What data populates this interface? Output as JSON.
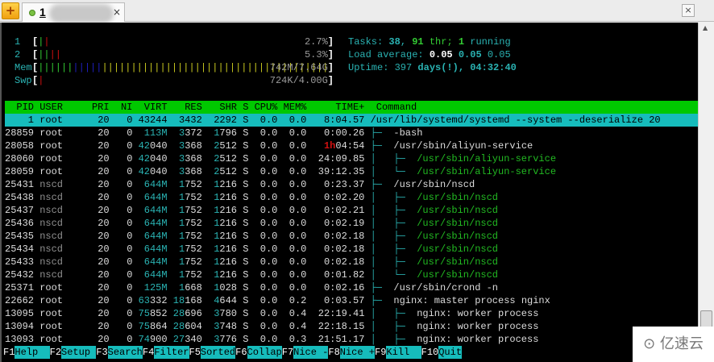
{
  "tabbar": {
    "tab_label": "1",
    "close": "×",
    "win_close": "×",
    "add": "+"
  },
  "meters": [
    {
      "label": "1",
      "value": "2.7%",
      "bars": [
        [
          "#33cc33",
          1
        ],
        [
          "#d01010",
          1
        ]
      ]
    },
    {
      "label": "2",
      "value": "5.3%",
      "bars": [
        [
          "#33cc33",
          2
        ],
        [
          "#d01010",
          2
        ]
      ]
    },
    {
      "label": "Mem",
      "value": "742M/7.64G",
      "bars": [
        [
          "#33cc33",
          6
        ],
        [
          "#2020c0",
          5
        ],
        [
          "#c8c820",
          40
        ]
      ]
    },
    {
      "label": "Swp",
      "value": "724K/4.00G",
      "bars": [
        [
          "#d01010",
          1
        ]
      ]
    }
  ],
  "stats": {
    "tasks_label": "Tasks: ",
    "tasks": "38",
    "thr": "91",
    "thr_label": " thr; ",
    "running": "1",
    "running_label": " running",
    "load_label": "Load average: ",
    "load1": "0.05",
    "load5": "0.05",
    "load15": "0.05",
    "uptime_label": "Uptime: ",
    "uptime_days": "397",
    "uptime_days_label": " days(!), ",
    "uptime_time": "04:32:40"
  },
  "columns": [
    "PID",
    "USER",
    "PRI",
    "NI",
    "VIRT",
    "RES",
    "SHR",
    "S",
    "CPU%",
    "MEM%",
    "TIME+",
    "Command"
  ],
  "processes": [
    {
      "pid": "1",
      "user": "root",
      "pri": "20",
      "ni": "0",
      "virt": "43244",
      "res": "3432",
      "shr": "2292",
      "s": "S",
      "cpu": "0.0",
      "mem": "0.0",
      "time": "8:04.57",
      "tree": "",
      "cmd": "/usr/lib/systemd/systemd --system --deserialize 20",
      "thread": false
    },
    {
      "pid": "28859",
      "user": "root",
      "pri": "20",
      "ni": "0",
      "virt": "113M",
      "res": "3372",
      "shr": "1796",
      "s": "S",
      "cpu": "0.0",
      "mem": "0.0",
      "time": "0:00.26",
      "tree": "├─  ",
      "cmd": "-bash",
      "thread": false
    },
    {
      "pid": "28058",
      "user": "root",
      "pri": "20",
      "ni": "0",
      "virt": "42040",
      "res": "3368",
      "shr": "2512",
      "s": "S",
      "cpu": "0.0",
      "mem": "0.0",
      "time": "1h04:54",
      "tree": "├─  ",
      "cmd": "/usr/sbin/aliyun-service",
      "thread": false
    },
    {
      "pid": "28060",
      "user": "root",
      "pri": "20",
      "ni": "0",
      "virt": "42040",
      "res": "3368",
      "shr": "2512",
      "s": "S",
      "cpu": "0.0",
      "mem": "0.0",
      "time": "24:09.85",
      "tree": "│   ├─  ",
      "cmd": "/usr/sbin/aliyun-service",
      "thread": true
    },
    {
      "pid": "28059",
      "user": "root",
      "pri": "20",
      "ni": "0",
      "virt": "42040",
      "res": "3368",
      "shr": "2512",
      "s": "S",
      "cpu": "0.0",
      "mem": "0.0",
      "time": "39:12.35",
      "tree": "│   └─  ",
      "cmd": "/usr/sbin/aliyun-service",
      "thread": true
    },
    {
      "pid": "25431",
      "user": "nscd",
      "pri": "20",
      "ni": "0",
      "virt": "644M",
      "res": "1752",
      "shr": "1216",
      "s": "S",
      "cpu": "0.0",
      "mem": "0.0",
      "time": "0:23.37",
      "tree": "├─  ",
      "cmd": "/usr/sbin/nscd",
      "thread": false
    },
    {
      "pid": "25438",
      "user": "nscd",
      "pri": "20",
      "ni": "0",
      "virt": "644M",
      "res": "1752",
      "shr": "1216",
      "s": "S",
      "cpu": "0.0",
      "mem": "0.0",
      "time": "0:02.20",
      "tree": "│   ├─  ",
      "cmd": "/usr/sbin/nscd",
      "thread": true
    },
    {
      "pid": "25437",
      "user": "nscd",
      "pri": "20",
      "ni": "0",
      "virt": "644M",
      "res": "1752",
      "shr": "1216",
      "s": "S",
      "cpu": "0.0",
      "mem": "0.0",
      "time": "0:02.21",
      "tree": "│   ├─  ",
      "cmd": "/usr/sbin/nscd",
      "thread": true
    },
    {
      "pid": "25436",
      "user": "nscd",
      "pri": "20",
      "ni": "0",
      "virt": "644M",
      "res": "1752",
      "shr": "1216",
      "s": "S",
      "cpu": "0.0",
      "mem": "0.0",
      "time": "0:02.19",
      "tree": "│   ├─  ",
      "cmd": "/usr/sbin/nscd",
      "thread": true
    },
    {
      "pid": "25435",
      "user": "nscd",
      "pri": "20",
      "ni": "0",
      "virt": "644M",
      "res": "1752",
      "shr": "1216",
      "s": "S",
      "cpu": "0.0",
      "mem": "0.0",
      "time": "0:02.18",
      "tree": "│   ├─  ",
      "cmd": "/usr/sbin/nscd",
      "thread": true
    },
    {
      "pid": "25434",
      "user": "nscd",
      "pri": "20",
      "ni": "0",
      "virt": "644M",
      "res": "1752",
      "shr": "1216",
      "s": "S",
      "cpu": "0.0",
      "mem": "0.0",
      "time": "0:02.18",
      "tree": "│   ├─  ",
      "cmd": "/usr/sbin/nscd",
      "thread": true
    },
    {
      "pid": "25433",
      "user": "nscd",
      "pri": "20",
      "ni": "0",
      "virt": "644M",
      "res": "1752",
      "shr": "1216",
      "s": "S",
      "cpu": "0.0",
      "mem": "0.0",
      "time": "0:02.18",
      "tree": "│   ├─  ",
      "cmd": "/usr/sbin/nscd",
      "thread": true
    },
    {
      "pid": "25432",
      "user": "nscd",
      "pri": "20",
      "ni": "0",
      "virt": "644M",
      "res": "1752",
      "shr": "1216",
      "s": "S",
      "cpu": "0.0",
      "mem": "0.0",
      "time": "0:01.82",
      "tree": "│   └─  ",
      "cmd": "/usr/sbin/nscd",
      "thread": true
    },
    {
      "pid": "25371",
      "user": "root",
      "pri": "20",
      "ni": "0",
      "virt": "125M",
      "res": "1668",
      "shr": "1028",
      "s": "S",
      "cpu": "0.0",
      "mem": "0.0",
      "time": "0:02.16",
      "tree": "├─  ",
      "cmd": "/usr/sbin/crond -n",
      "thread": false
    },
    {
      "pid": "22662",
      "user": "root",
      "pri": "20",
      "ni": "0",
      "virt": "63332",
      "res": "18168",
      "shr": "4644",
      "s": "S",
      "cpu": "0.0",
      "mem": "0.2",
      "time": "0:03.57",
      "tree": "├─  ",
      "cmd": "nginx: master process nginx",
      "thread": false
    },
    {
      "pid": "13095",
      "user": "root",
      "pri": "20",
      "ni": "0",
      "virt": "75852",
      "res": "28696",
      "shr": "3780",
      "s": "S",
      "cpu": "0.0",
      "mem": "0.4",
      "time": "22:19.41",
      "tree": "│   ├─  ",
      "cmd": "nginx: worker process",
      "thread": false
    },
    {
      "pid": "13094",
      "user": "root",
      "pri": "20",
      "ni": "0",
      "virt": "75864",
      "res": "28604",
      "shr": "3748",
      "s": "S",
      "cpu": "0.0",
      "mem": "0.4",
      "time": "22:18.15",
      "tree": "│   ├─  ",
      "cmd": "nginx: worker process",
      "thread": false
    },
    {
      "pid": "13093",
      "user": "root",
      "pri": "20",
      "ni": "0",
      "virt": "74900",
      "res": "27340",
      "shr": "3776",
      "s": "S",
      "cpu": "0.0",
      "mem": "0.3",
      "time": "21:51.17",
      "tree": "│   ├─  ",
      "cmd": "nginx: worker process",
      "thread": false
    }
  ],
  "footer": [
    {
      "key": "F1",
      "label": "Help  "
    },
    {
      "key": "F2",
      "label": "Setup "
    },
    {
      "key": "F3",
      "label": "Search"
    },
    {
      "key": "F4",
      "label": "Filter"
    },
    {
      "key": "F5",
      "label": "Sorted"
    },
    {
      "key": "F6",
      "label": "Collap"
    },
    {
      "key": "F7",
      "label": "Nice -"
    },
    {
      "key": "F8",
      "label": "Nice +"
    },
    {
      "key": "F9",
      "label": "Kill  "
    },
    {
      "key": "F10",
      "label": "Quit"
    }
  ],
  "watermark": "亿速云"
}
